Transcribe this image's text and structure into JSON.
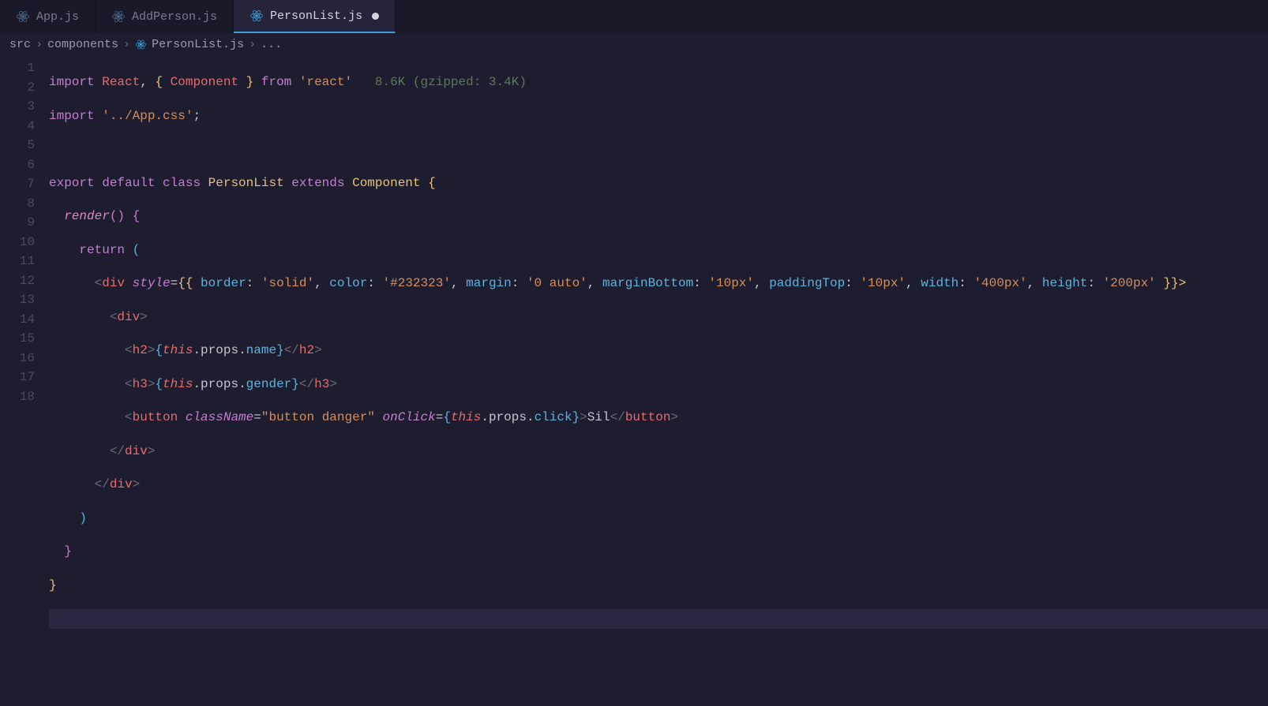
{
  "tabs": [
    {
      "label": "App.js",
      "active": false,
      "dirty": false
    },
    {
      "label": "AddPerson.js",
      "active": false,
      "dirty": false
    },
    {
      "label": "PersonList.js",
      "active": true,
      "dirty": true
    }
  ],
  "breadcrumb": {
    "seg0": "src",
    "seg1": "components",
    "seg2": "PersonList.js",
    "seg3": "..."
  },
  "hint": "8.6K (gzipped: 3.4K)",
  "lines": [
    "1",
    "2",
    "3",
    "4",
    "5",
    "6",
    "7",
    "8",
    "9",
    "10",
    "11",
    "12",
    "13",
    "14",
    "15",
    "16",
    "17",
    "18"
  ],
  "code": {
    "l1_import": "import",
    "l1_react": "React",
    "l1_comma": ", ",
    "l1_lb": "{ ",
    "l1_comp": "Component",
    "l1_rb": " }",
    "l1_from": " from ",
    "l1_str": "'react'",
    "l2_import": "import",
    "l2_str": "'../App.css'",
    "l2_semi": ";",
    "l4_export": "export",
    "l4_default": " default ",
    "l4_class": "class",
    "l4_name": " PersonList",
    "l4_extends": " extends ",
    "l4_comp": "Component",
    "l4_brace": " {",
    "l5_render": "render",
    "l5_parens": "()",
    "l5_brace": " {",
    "l6_return": "return",
    "l6_paren": " (",
    "l7_open": "<",
    "l7_div": "div",
    "l7_style": " style",
    "l7_eq": "=",
    "l7_bb": "{{",
    "l7_border_k": " border",
    "l7_colon": ": ",
    "l7_border_v": "'solid'",
    "l7_c": ", ",
    "l7_color_k": "color",
    "l7_color_v": "'#232323'",
    "l7_margin_k": "margin",
    "l7_margin_v": "'0 auto'",
    "l7_mb_k": "marginBottom",
    "l7_mb_v": "'10px'",
    "l7_pt_k": "paddingTop",
    "l7_pt_v": "'10px'",
    "l7_w_k": "width",
    "l7_w_v": "'400px'",
    "l7_h_k": "height",
    "l7_h_v": "'200px'",
    "l7_close": " }}>",
    "l8": "<div>",
    "l9_open": "<h2>",
    "l9_lb": "{",
    "l9_this": "this",
    "l9_props": ".props.",
    "l9_name": "name",
    "l9_rb": "}",
    "l9_close": "</h2>",
    "l10_open": "<h3>",
    "l10_lb": "{",
    "l10_this": "this",
    "l10_props": ".props.",
    "l10_gender": "gender",
    "l10_rb": "}",
    "l10_close": "</h3>",
    "l11_open": "<button ",
    "l11_cn": "className",
    "l11_eq": "=",
    "l11_cnv": "\"button danger\"",
    "l11_oc": " onClick",
    "l11_lb": "{",
    "l11_this": "this",
    "l11_props": ".props.",
    "l11_click": "click",
    "l11_rb": "}",
    "l11_gt": ">",
    "l11_txt": "Sil",
    "l11_close": "</button>",
    "l12": "</div>",
    "l13": "</div>",
    "l14": ")",
    "l15": "}",
    "l16": "}"
  }
}
